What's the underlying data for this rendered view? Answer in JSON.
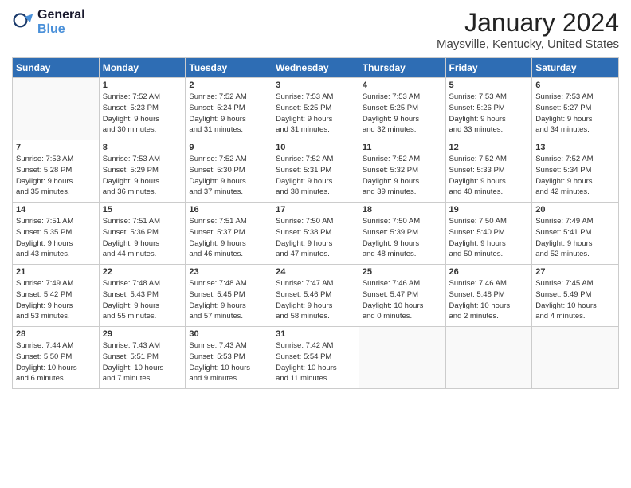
{
  "header": {
    "logo_line1": "General",
    "logo_line2": "Blue",
    "month": "January 2024",
    "location": "Maysville, Kentucky, United States"
  },
  "weekdays": [
    "Sunday",
    "Monday",
    "Tuesday",
    "Wednesday",
    "Thursday",
    "Friday",
    "Saturday"
  ],
  "weeks": [
    [
      {
        "day": "",
        "empty": true
      },
      {
        "day": "1",
        "sunrise": "Sunrise: 7:52 AM",
        "sunset": "Sunset: 5:23 PM",
        "daylight": "Daylight: 9 hours and 30 minutes."
      },
      {
        "day": "2",
        "sunrise": "Sunrise: 7:52 AM",
        "sunset": "Sunset: 5:24 PM",
        "daylight": "Daylight: 9 hours and 31 minutes."
      },
      {
        "day": "3",
        "sunrise": "Sunrise: 7:53 AM",
        "sunset": "Sunset: 5:25 PM",
        "daylight": "Daylight: 9 hours and 31 minutes."
      },
      {
        "day": "4",
        "sunrise": "Sunrise: 7:53 AM",
        "sunset": "Sunset: 5:25 PM",
        "daylight": "Daylight: 9 hours and 32 minutes."
      },
      {
        "day": "5",
        "sunrise": "Sunrise: 7:53 AM",
        "sunset": "Sunset: 5:26 PM",
        "daylight": "Daylight: 9 hours and 33 minutes."
      },
      {
        "day": "6",
        "sunrise": "Sunrise: 7:53 AM",
        "sunset": "Sunset: 5:27 PM",
        "daylight": "Daylight: 9 hours and 34 minutes."
      }
    ],
    [
      {
        "day": "7",
        "sunrise": "Sunrise: 7:53 AM",
        "sunset": "Sunset: 5:28 PM",
        "daylight": "Daylight: 9 hours and 35 minutes."
      },
      {
        "day": "8",
        "sunrise": "Sunrise: 7:53 AM",
        "sunset": "Sunset: 5:29 PM",
        "daylight": "Daylight: 9 hours and 36 minutes."
      },
      {
        "day": "9",
        "sunrise": "Sunrise: 7:52 AM",
        "sunset": "Sunset: 5:30 PM",
        "daylight": "Daylight: 9 hours and 37 minutes."
      },
      {
        "day": "10",
        "sunrise": "Sunrise: 7:52 AM",
        "sunset": "Sunset: 5:31 PM",
        "daylight": "Daylight: 9 hours and 38 minutes."
      },
      {
        "day": "11",
        "sunrise": "Sunrise: 7:52 AM",
        "sunset": "Sunset: 5:32 PM",
        "daylight": "Daylight: 9 hours and 39 minutes."
      },
      {
        "day": "12",
        "sunrise": "Sunrise: 7:52 AM",
        "sunset": "Sunset: 5:33 PM",
        "daylight": "Daylight: 9 hours and 40 minutes."
      },
      {
        "day": "13",
        "sunrise": "Sunrise: 7:52 AM",
        "sunset": "Sunset: 5:34 PM",
        "daylight": "Daylight: 9 hours and 42 minutes."
      }
    ],
    [
      {
        "day": "14",
        "sunrise": "Sunrise: 7:51 AM",
        "sunset": "Sunset: 5:35 PM",
        "daylight": "Daylight: 9 hours and 43 minutes."
      },
      {
        "day": "15",
        "sunrise": "Sunrise: 7:51 AM",
        "sunset": "Sunset: 5:36 PM",
        "daylight": "Daylight: 9 hours and 44 minutes."
      },
      {
        "day": "16",
        "sunrise": "Sunrise: 7:51 AM",
        "sunset": "Sunset: 5:37 PM",
        "daylight": "Daylight: 9 hours and 46 minutes."
      },
      {
        "day": "17",
        "sunrise": "Sunrise: 7:50 AM",
        "sunset": "Sunset: 5:38 PM",
        "daylight": "Daylight: 9 hours and 47 minutes."
      },
      {
        "day": "18",
        "sunrise": "Sunrise: 7:50 AM",
        "sunset": "Sunset: 5:39 PM",
        "daylight": "Daylight: 9 hours and 48 minutes."
      },
      {
        "day": "19",
        "sunrise": "Sunrise: 7:50 AM",
        "sunset": "Sunset: 5:40 PM",
        "daylight": "Daylight: 9 hours and 50 minutes."
      },
      {
        "day": "20",
        "sunrise": "Sunrise: 7:49 AM",
        "sunset": "Sunset: 5:41 PM",
        "daylight": "Daylight: 9 hours and 52 minutes."
      }
    ],
    [
      {
        "day": "21",
        "sunrise": "Sunrise: 7:49 AM",
        "sunset": "Sunset: 5:42 PM",
        "daylight": "Daylight: 9 hours and 53 minutes."
      },
      {
        "day": "22",
        "sunrise": "Sunrise: 7:48 AM",
        "sunset": "Sunset: 5:43 PM",
        "daylight": "Daylight: 9 hours and 55 minutes."
      },
      {
        "day": "23",
        "sunrise": "Sunrise: 7:48 AM",
        "sunset": "Sunset: 5:45 PM",
        "daylight": "Daylight: 9 hours and 57 minutes."
      },
      {
        "day": "24",
        "sunrise": "Sunrise: 7:47 AM",
        "sunset": "Sunset: 5:46 PM",
        "daylight": "Daylight: 9 hours and 58 minutes."
      },
      {
        "day": "25",
        "sunrise": "Sunrise: 7:46 AM",
        "sunset": "Sunset: 5:47 PM",
        "daylight": "Daylight: 10 hours and 0 minutes."
      },
      {
        "day": "26",
        "sunrise": "Sunrise: 7:46 AM",
        "sunset": "Sunset: 5:48 PM",
        "daylight": "Daylight: 10 hours and 2 minutes."
      },
      {
        "day": "27",
        "sunrise": "Sunrise: 7:45 AM",
        "sunset": "Sunset: 5:49 PM",
        "daylight": "Daylight: 10 hours and 4 minutes."
      }
    ],
    [
      {
        "day": "28",
        "sunrise": "Sunrise: 7:44 AM",
        "sunset": "Sunset: 5:50 PM",
        "daylight": "Daylight: 10 hours and 6 minutes."
      },
      {
        "day": "29",
        "sunrise": "Sunrise: 7:43 AM",
        "sunset": "Sunset: 5:51 PM",
        "daylight": "Daylight: 10 hours and 7 minutes."
      },
      {
        "day": "30",
        "sunrise": "Sunrise: 7:43 AM",
        "sunset": "Sunset: 5:53 PM",
        "daylight": "Daylight: 10 hours and 9 minutes."
      },
      {
        "day": "31",
        "sunrise": "Sunrise: 7:42 AM",
        "sunset": "Sunset: 5:54 PM",
        "daylight": "Daylight: 10 hours and 11 minutes."
      },
      {
        "day": "",
        "empty": true
      },
      {
        "day": "",
        "empty": true
      },
      {
        "day": "",
        "empty": true
      }
    ]
  ]
}
